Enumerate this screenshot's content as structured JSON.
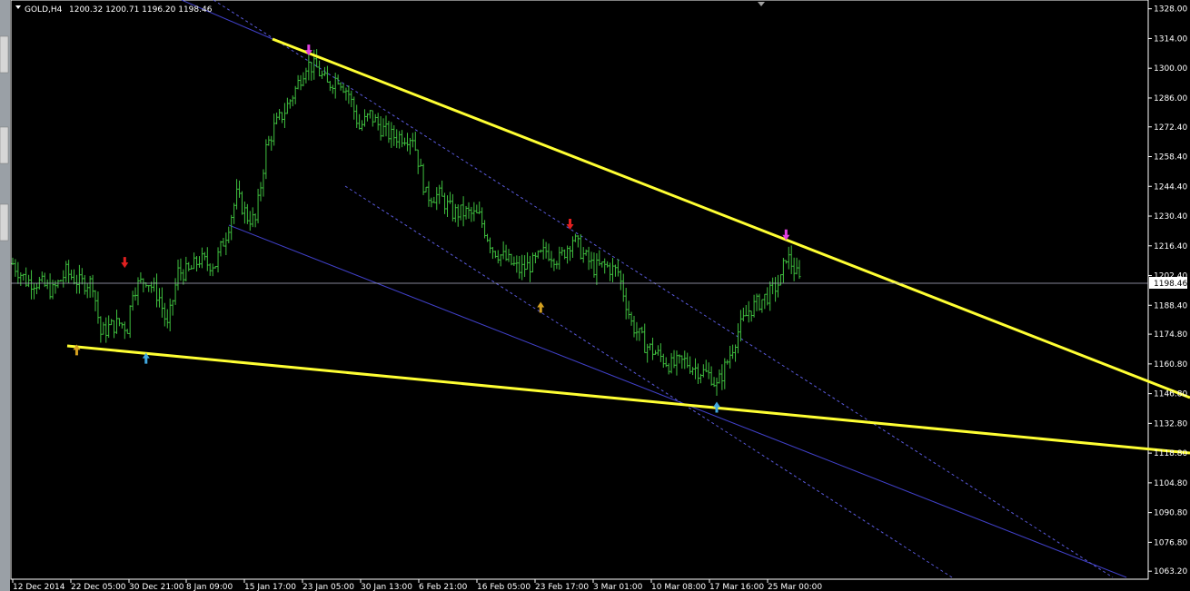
{
  "header": {
    "symbol": "GOLD,H4",
    "ohlc": "1200.32 1200.71 1196.20 1198.46"
  },
  "price_marker": "1198.46",
  "colors": {
    "background": "#000000",
    "bars": "#3fc03f",
    "trendline": "#ffff33",
    "channel": "#4040c8",
    "axis": "#ffffff"
  },
  "chart_data": {
    "type": "ohlc",
    "y_ticks": [
      "1328.00",
      "1314.00",
      "1300.00",
      "1286.00",
      "1272.40",
      "1258.40",
      "1244.40",
      "1230.40",
      "1216.40",
      "1202.40",
      "1188.40",
      "1174.80",
      "1160.80",
      "1146.80",
      "1132.80",
      "1118.80",
      "1104.80",
      "1090.80",
      "1076.80",
      "1063.20"
    ],
    "ylim": [
      1062,
      1330
    ],
    "x_ticks": [
      "12 Dec 2014",
      "22 Dec 05:00",
      "30 Dec 21:00",
      "8 Jan 09:00",
      "15 Jan 17:00",
      "23 Jan 05:00",
      "30 Jan 13:00",
      "6 Feb 21:00",
      "16 Feb 05:00",
      "23 Feb 17:00",
      "3 Mar 01:00",
      "10 Mar 08:00",
      "17 Mar 16:00",
      "25 Mar 00:00"
    ],
    "last_price": 1198.46,
    "price_path": [
      [
        0,
        1208
      ],
      [
        5,
        1200
      ],
      [
        10,
        1199
      ],
      [
        15,
        1195
      ],
      [
        20,
        1204
      ],
      [
        25,
        1199
      ],
      [
        30,
        1199
      ],
      [
        33,
        1175
      ],
      [
        36,
        1178
      ],
      [
        40,
        1180
      ],
      [
        43,
        1178
      ],
      [
        45,
        1196
      ],
      [
        50,
        1201
      ],
      [
        55,
        1192
      ],
      [
        58,
        1178
      ],
      [
        62,
        1204
      ],
      [
        66,
        1204
      ],
      [
        70,
        1210
      ],
      [
        73,
        1208
      ],
      [
        76,
        1208
      ],
      [
        80,
        1222
      ],
      [
        84,
        1240
      ],
      [
        88,
        1230
      ],
      [
        91,
        1228
      ],
      [
        95,
        1262
      ],
      [
        98,
        1272
      ],
      [
        102,
        1280
      ],
      [
        106,
        1290
      ],
      [
        110,
        1302
      ],
      [
        114,
        1300
      ],
      [
        118,
        1292
      ],
      [
        122,
        1296
      ],
      [
        126,
        1288
      ],
      [
        130,
        1272
      ],
      [
        134,
        1278
      ],
      [
        138,
        1272
      ],
      [
        142,
        1268
      ],
      [
        146,
        1268
      ],
      [
        150,
        1268
      ],
      [
        155,
        1240
      ],
      [
        160,
        1240
      ],
      [
        165,
        1232
      ],
      [
        170,
        1232
      ],
      [
        175,
        1230
      ],
      [
        180,
        1215
      ],
      [
        185,
        1210
      ],
      [
        190,
        1205
      ],
      [
        195,
        1208
      ],
      [
        200,
        1214
      ],
      [
        205,
        1210
      ],
      [
        210,
        1220
      ],
      [
        214,
        1212
      ],
      [
        218,
        1206
      ],
      [
        222,
        1207
      ],
      [
        227,
        1204
      ],
      [
        232,
        1180
      ],
      [
        237,
        1170
      ],
      [
        242,
        1165
      ],
      [
        247,
        1160
      ],
      [
        252,
        1162
      ],
      [
        257,
        1158
      ],
      [
        262,
        1155
      ],
      [
        264,
        1150
      ],
      [
        268,
        1162
      ],
      [
        272,
        1176
      ],
      [
        276,
        1186
      ],
      [
        280,
        1190
      ],
      [
        284,
        1194
      ],
      [
        288,
        1200
      ],
      [
        290,
        1212
      ],
      [
        292,
        1208
      ],
      [
        295,
        1200
      ]
    ],
    "n_bars": 296,
    "arrows": [
      {
        "bar": 42,
        "dir": "down",
        "color": "#e02020",
        "price": 1206
      },
      {
        "bar": 111,
        "dir": "down",
        "color": "#e040e0",
        "price": 1306
      },
      {
        "bar": 209,
        "dir": "down",
        "color": "#e02020",
        "price": 1224
      },
      {
        "bar": 290,
        "dir": "down",
        "color": "#e040e0",
        "price": 1219
      },
      {
        "bar": 24,
        "dir": "up",
        "color": "#d4a020",
        "price": 1170
      },
      {
        "bar": 50,
        "dir": "up",
        "color": "#40a8e0",
        "price": 1166
      },
      {
        "bar": 198,
        "dir": "up",
        "color": "#d4a020",
        "price": 1190
      },
      {
        "bar": 264,
        "dir": "up",
        "color": "#40a8e0",
        "price": 1143
      }
    ]
  }
}
